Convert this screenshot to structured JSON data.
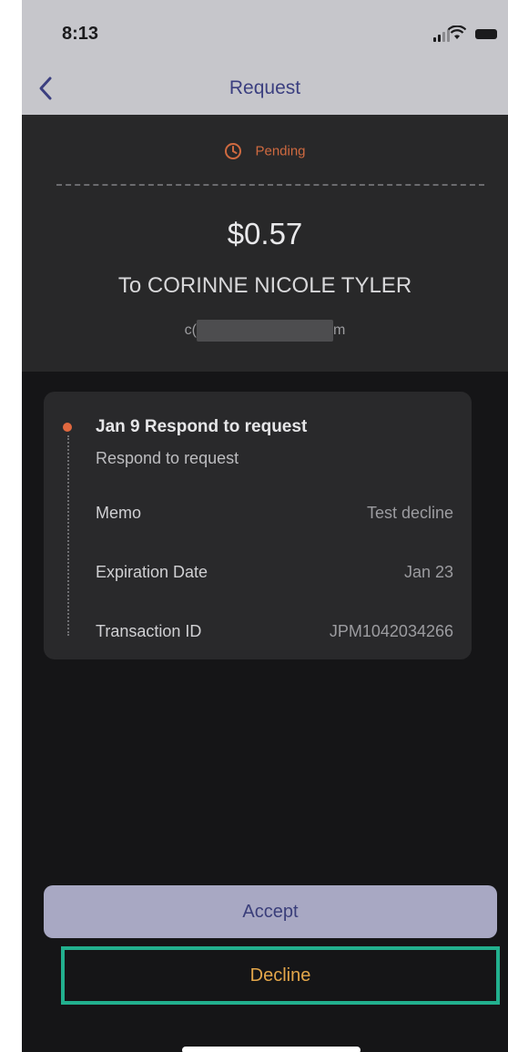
{
  "status_bar": {
    "time": "8:13"
  },
  "nav": {
    "title": "Request",
    "back_icon": "chevron-left-icon"
  },
  "summary": {
    "status": "Pending",
    "status_color": "#cf6a40",
    "amount": "$0.57",
    "recipient": "To CORINNE NICOLE TYLER",
    "email_start": "c(",
    "email_end": "m"
  },
  "details": {
    "event_title": "Jan 9 Respond to request",
    "event_subtitle": "Respond to request",
    "rows": [
      {
        "label": "Memo",
        "value": "Test decline"
      },
      {
        "label": "Expiration Date",
        "value": "Jan 23"
      },
      {
        "label": "Transaction ID",
        "value": "JPM1042034266"
      }
    ]
  },
  "actions": {
    "accept_label": "Accept",
    "decline_label": "Decline",
    "accent_color": "#22b08e"
  }
}
